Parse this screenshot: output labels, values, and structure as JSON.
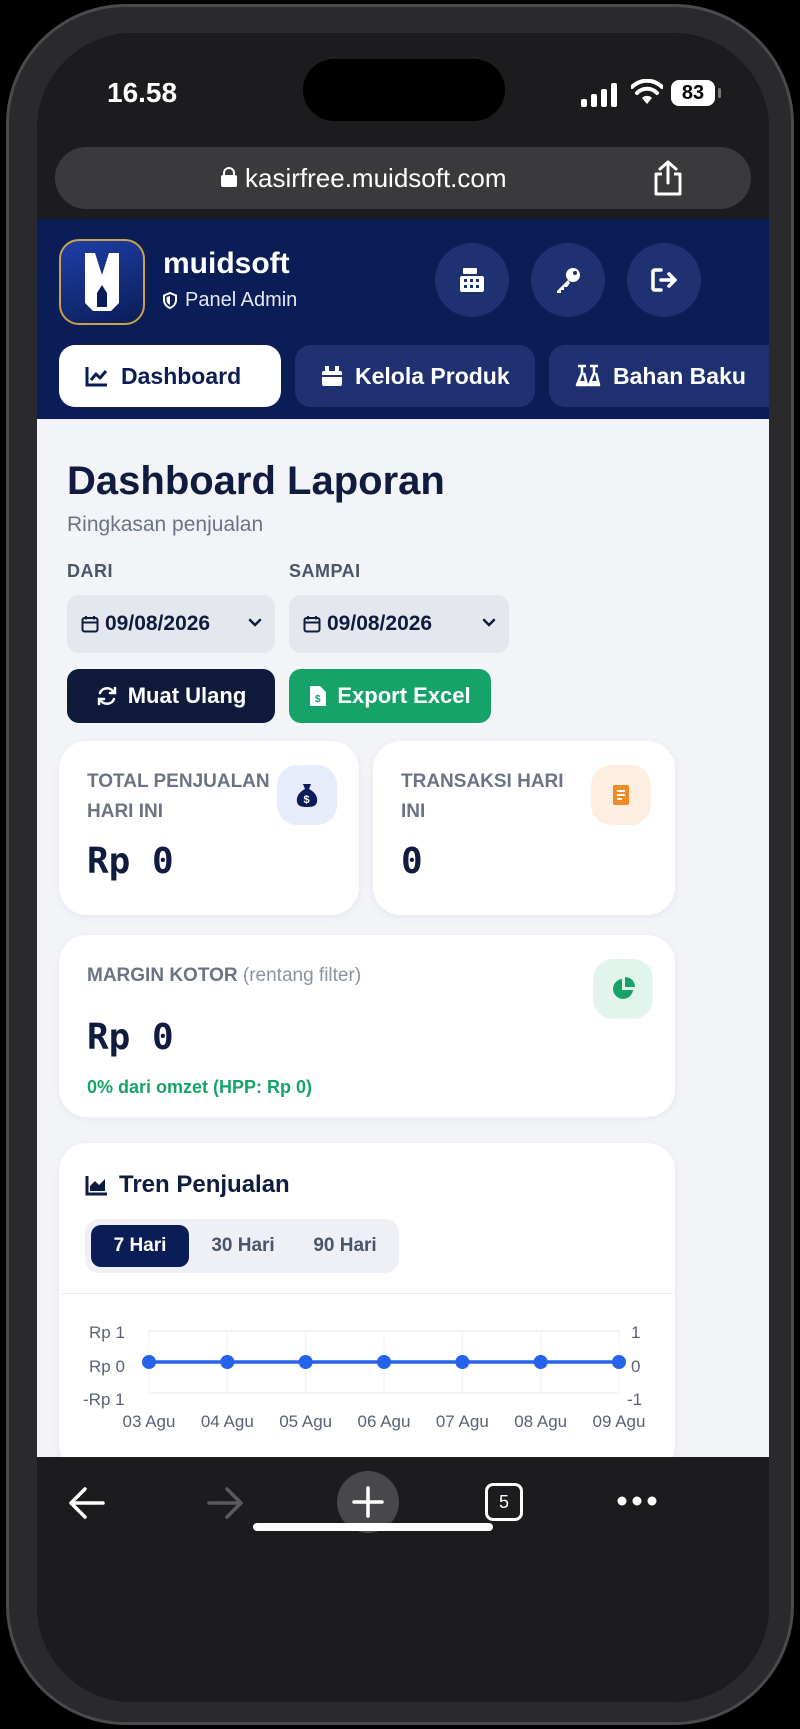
{
  "status_bar": {
    "time": "16.58",
    "battery": "83"
  },
  "browser": {
    "url": "kasirfree.muidsoft.com",
    "tab_count": "5"
  },
  "header": {
    "brand": "muidsoft",
    "panel_label": "Panel Admin",
    "tabs": [
      {
        "label": "Dashboard",
        "active": true
      },
      {
        "label": "Kelola Produk",
        "active": false
      },
      {
        "label": "Bahan Baku",
        "active": false
      }
    ]
  },
  "page": {
    "title": "Dashboard Laporan",
    "subtitle": "Ringkasan penjualan",
    "from_label": "DARI",
    "to_label": "SAMPAI",
    "from_date": "09/08/2026",
    "to_date": "09/08/2026",
    "reload_label": "Muat Ulang",
    "export_label": "Export Excel"
  },
  "cards": {
    "total_sales": {
      "label_line1": "TOTAL PENJUALAN",
      "label_line2": "HARI INI",
      "value": "Rp 0"
    },
    "transactions": {
      "label_line1": "TRANSAKSI HARI",
      "label_line2": "INI",
      "value": "0"
    },
    "margin": {
      "label": "MARGIN KOTOR",
      "label_hint": "(rentang filter)",
      "value": "Rp 0",
      "note": "0% dari omzet (HPP: Rp 0)"
    }
  },
  "trend": {
    "title": "Tren Penjualan",
    "ranges": [
      {
        "label": "7 Hari",
        "active": true
      },
      {
        "label": "30 Hari",
        "active": false
      },
      {
        "label": "90 Hari",
        "active": false
      }
    ]
  },
  "colors": {
    "navy": "#0b1d57",
    "green": "#16a36a",
    "line": "#2563eb",
    "orange": "#f08a24"
  },
  "chart_data": {
    "type": "line",
    "x": [
      "03 Agu",
      "04 Agu",
      "05 Agu",
      "06 Agu",
      "07 Agu",
      "08 Agu",
      "09 Agu"
    ],
    "series": [
      {
        "values": [
          0,
          0,
          0,
          0,
          0,
          0,
          0
        ]
      }
    ],
    "y_left_ticks": [
      "Rp 1",
      "Rp 0",
      "-Rp 1"
    ],
    "y_right_ticks": [
      "1",
      "0",
      "-1"
    ],
    "ylim": [
      -1,
      1
    ],
    "grid": true
  }
}
